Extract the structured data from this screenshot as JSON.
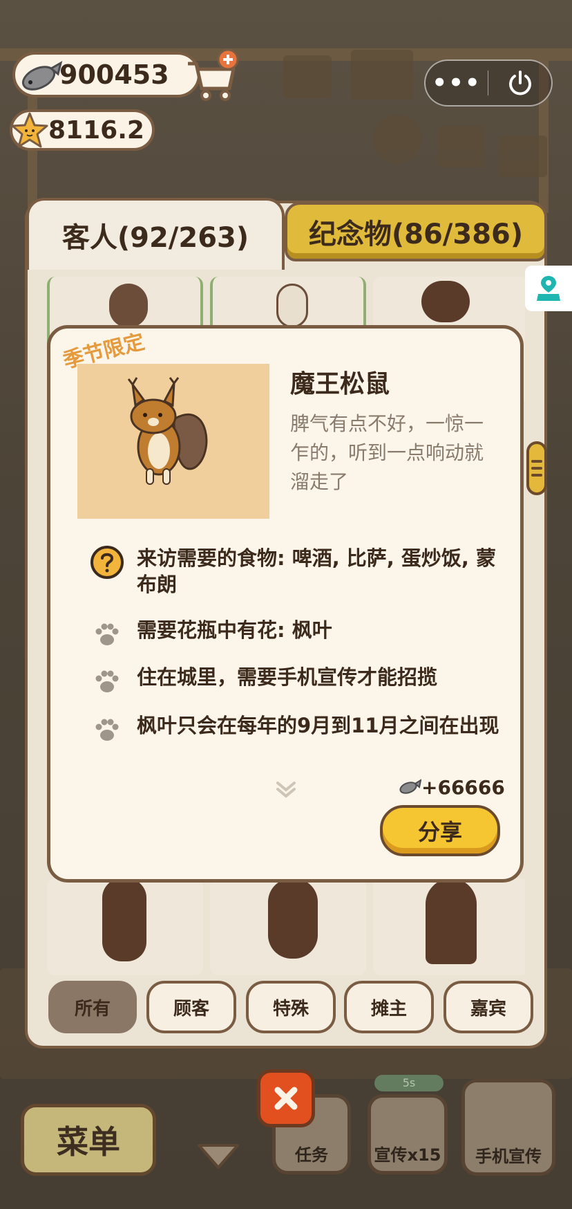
{
  "currency": {
    "fish": "900453",
    "stars": "8116.2"
  },
  "tabs": {
    "guests": "客人(92/263)",
    "souvenirs": "纪念物(86/386)"
  },
  "card": {
    "season_tag": "季节限定",
    "name": "魔王松鼠",
    "description": "脾气有点不好，一惊一乍的，听到一点响动就溜走了",
    "requirements": [
      {
        "icon": "question-icon",
        "text": "来访需要的食物: 啤酒, 比萨, 蛋炒饭, 蒙布朗"
      },
      {
        "icon": "paw-icon",
        "text": "需要花瓶中有花: 枫叶"
      },
      {
        "icon": "paw-icon",
        "text": "住在城里，需要手机宣传才能招揽"
      },
      {
        "icon": "paw-icon",
        "text": "枫叶只会在每年的9月到11月之间在出现"
      }
    ],
    "reward": "+66666",
    "share_label": "分享"
  },
  "filters": [
    "所有",
    "顾客",
    "特殊",
    "摊主",
    "嘉宾"
  ],
  "bottom": {
    "menu_label": "菜单",
    "tasks_label": "任务",
    "promo_label": "宣传x15",
    "phone_promo_label": "手机宣传",
    "timer": "5s"
  },
  "colors": {
    "accent": "#f5c532",
    "panel_border": "#7a5c43",
    "close": "#e2501f"
  }
}
